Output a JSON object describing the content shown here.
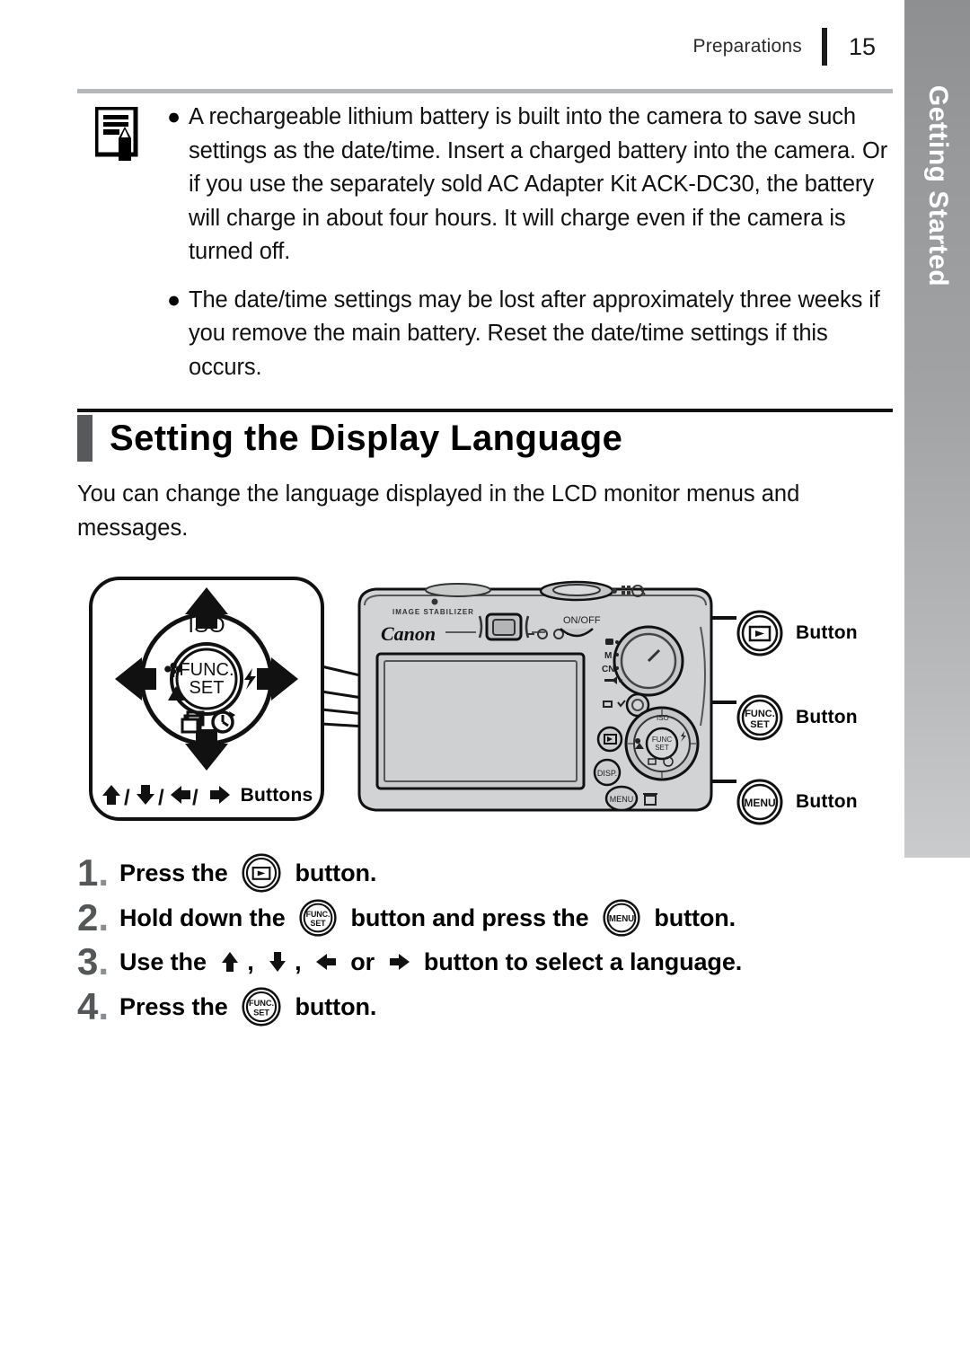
{
  "header": {
    "section": "Preparations",
    "page_number": "15"
  },
  "side_tab": {
    "label": "Getting Started",
    "color": "#a0a2a4"
  },
  "note": {
    "icon": "note-pencil-icon",
    "bullets": [
      "A rechargeable lithium battery is built into the camera to save such settings as the date/time. Insert a charged battery into the camera. Or if you use the separately sold AC Adapter Kit ACK-DC30, the battery will charge in about four hours. It will charge even if the camera is turned off.",
      "The date/time settings may be lost after approximately three weeks if you remove the main battery. Reset the date/time settings if this occurs."
    ]
  },
  "heading": {
    "title": "Setting the Display Language",
    "accent_color": "#58595b"
  },
  "intro": "You can change the language displayed in the LCD monitor menus and messages.",
  "figure": {
    "nav_panel": {
      "center_label_top": "FUNC.",
      "center_label_bottom": "SET",
      "iso_label": "ISO",
      "caption": "Buttons",
      "caption_arrows": "↑/↓/←/→"
    },
    "camera": {
      "brand": "Canon",
      "stabilizer_text": "IMAGE STABILIZER",
      "power_text": "ON/OFF",
      "disp_text": "DISP.",
      "menu_text": "MENU",
      "func_text_top": "FUNC",
      "func_text_bottom": "SET",
      "dial_labels": [
        "M",
        "CN"
      ]
    },
    "callouts": [
      {
        "icon": "playback-button-icon",
        "label": "Button"
      },
      {
        "icon": "func-set-button-icon",
        "label": "Button"
      },
      {
        "icon": "menu-button-icon",
        "label": "Button"
      }
    ]
  },
  "steps": [
    {
      "number": "1",
      "parts": [
        {
          "type": "text",
          "value": "Press the "
        },
        {
          "type": "icon",
          "value": "playback-button-icon"
        },
        {
          "type": "text",
          "value": " button."
        }
      ]
    },
    {
      "number": "2",
      "parts": [
        {
          "type": "text",
          "value": "Hold down the "
        },
        {
          "type": "icon",
          "value": "func-set-button-icon"
        },
        {
          "type": "text",
          "value": " button and press the "
        },
        {
          "type": "icon",
          "value": "menu-button-icon"
        },
        {
          "type": "text",
          "value": " button."
        }
      ]
    },
    {
      "number": "3",
      "parts": [
        {
          "type": "text",
          "value": "Use the "
        },
        {
          "type": "icon",
          "value": "arrow-up-icon"
        },
        {
          "type": "text",
          "value": ", "
        },
        {
          "type": "icon",
          "value": "arrow-down-icon"
        },
        {
          "type": "text",
          "value": ", "
        },
        {
          "type": "icon",
          "value": "arrow-left-icon"
        },
        {
          "type": "text",
          "value": " or "
        },
        {
          "type": "icon",
          "value": "arrow-right-icon"
        },
        {
          "type": "text",
          "value": " button to select a language."
        }
      ]
    },
    {
      "number": "4",
      "parts": [
        {
          "type": "text",
          "value": "Press the "
        },
        {
          "type": "icon",
          "value": "func-set-button-icon"
        },
        {
          "type": "text",
          "value": " button."
        }
      ]
    }
  ]
}
